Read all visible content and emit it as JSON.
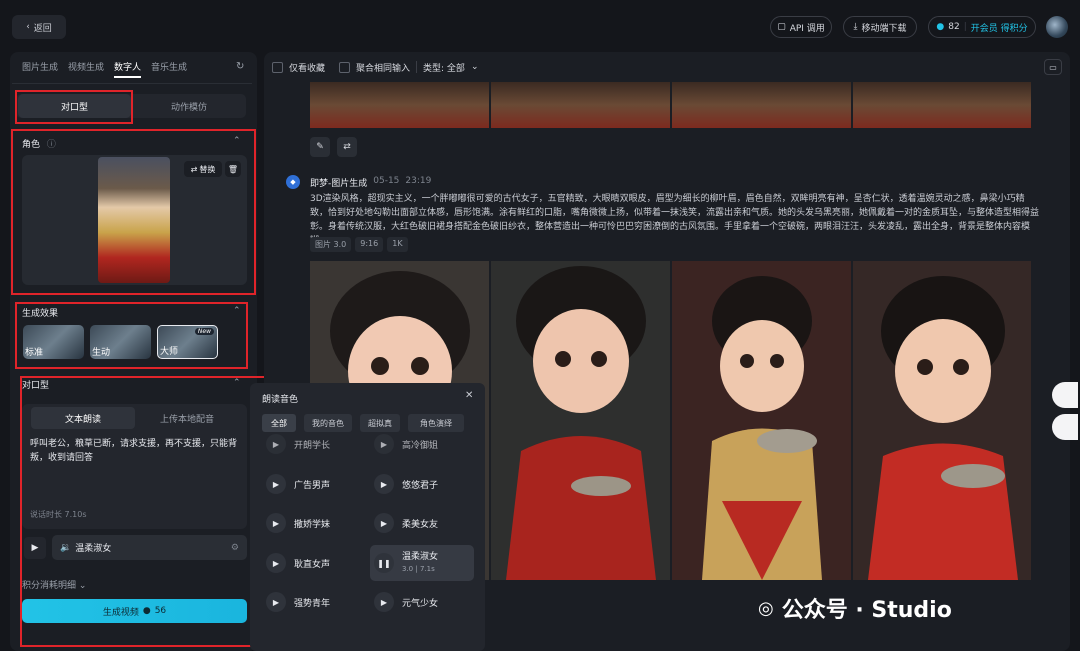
{
  "topbar": {
    "back_label": "返回",
    "api_label": "API 调用",
    "download_label": "移动端下载",
    "points": "82",
    "vip_label": "开会员 得积分"
  },
  "left": {
    "tabs": [
      "图片生成",
      "视频生成",
      "数字人",
      "音乐生成"
    ],
    "modes": [
      "对口型",
      "动作模仿"
    ],
    "role_title": "角色",
    "swap_label": "替换",
    "effect_title": "生成效果",
    "effects": [
      "标准",
      "生动",
      "大师"
    ],
    "new_badge": "New",
    "lipsync_title": "对口型",
    "input_tabs": [
      "文本朗读",
      "上传本地配音"
    ],
    "script": "呼叫老公，粮草已断，请求支援，再不支援，只能背叛，收到请回答",
    "duration": "说话时长 7.10s",
    "voice": "温柔淑女",
    "cost_label": "积分消耗明细",
    "generate_label": "生成视频",
    "generate_cost": "56"
  },
  "right": {
    "filters": [
      "仅看收藏",
      "聚合相同输入"
    ],
    "type_label": "类型: 全部",
    "source": "即梦-图片生成",
    "date": "05-15",
    "time": "23:19",
    "prompt": "3D渲染风格，超现实主义，一个胖嘟嘟很可爱的古代女子，五官精致，大眼睛双眼皮，眉型为细长的柳叶眉，眉色自然，双眸明亮有神，呈杏仁状，透着温婉灵动之感，鼻梁小巧精致，恰到好处地勾勒出面部立体感，唇形饱满。涂有鲜红的口脂，嘴角微微上扬，似带着一抹浅笑，流露出亲和气质。她的头发乌黑亮丽，她佩戴着一对的金质耳坠，与整体造型相得益彰。身着传统汉服，大红色破旧裙身搭配金色破旧纱衣，整体营造出一种可怜巴巴穷困潦倒的古风氛围。手里拿着一个空破碗，两眼泪汪汪，头发凌乱，露出全身，背景是整体内容模糊。",
    "tags": [
      "图片 3.0",
      "9:16",
      "1K"
    ]
  },
  "popup": {
    "title": "朗读音色",
    "tabs": [
      "全部",
      "我的音色",
      "超拟真",
      "角色演绎"
    ],
    "voices_left": [
      "开朗学长",
      "广告男声",
      "撒娇学妹",
      "耿直女声",
      "强势青年"
    ],
    "voices_right": [
      "高冷御姐",
      "悠悠君子",
      "柔美女友",
      "温柔淑女",
      "元气少女"
    ],
    "selected_meta": "3.0 | 7.1s"
  },
  "watermark": "公众号 · Studio"
}
